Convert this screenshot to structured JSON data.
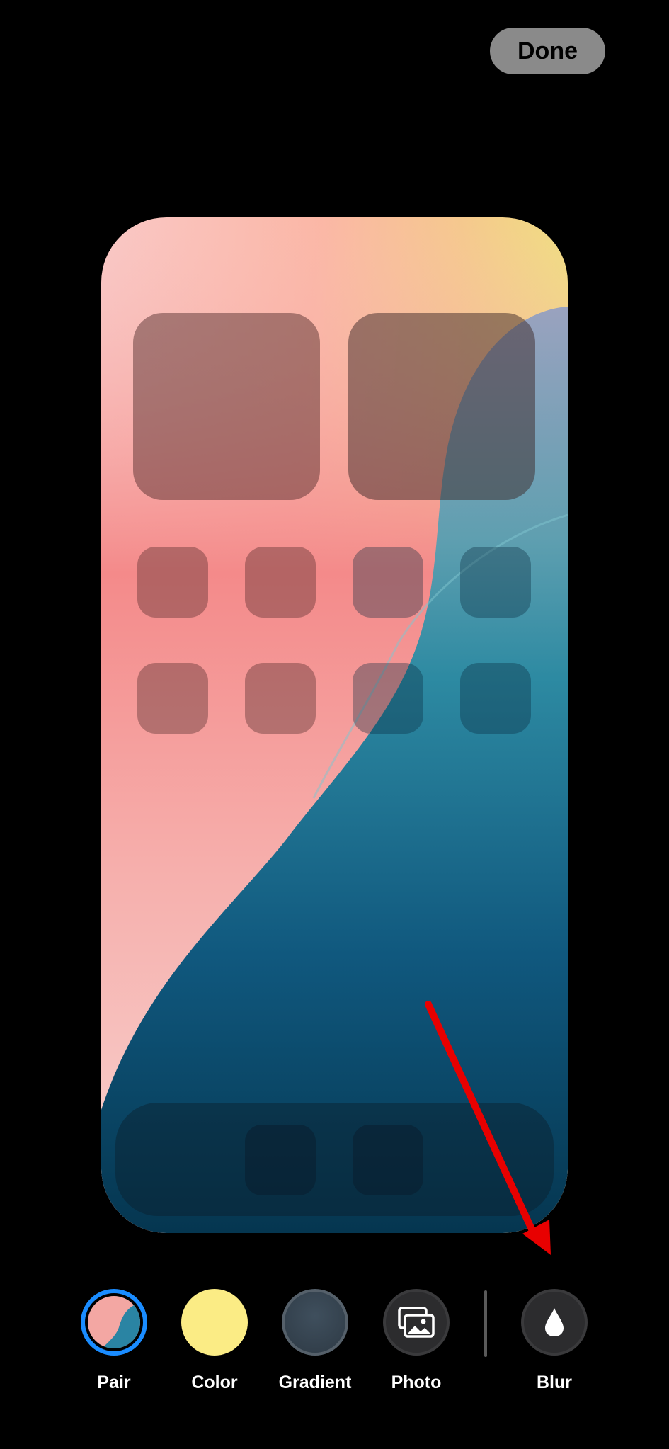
{
  "header": {
    "done_label": "Done"
  },
  "toolbar": {
    "items": [
      {
        "label": "Pair",
        "icon": "pair-wallpaper-icon",
        "selected": true
      },
      {
        "label": "Color",
        "icon": "color-swatch-icon",
        "color": "#fbec85"
      },
      {
        "label": "Gradient",
        "icon": "gradient-swatch-icon",
        "color": "#3a4a58"
      },
      {
        "label": "Photo",
        "icon": "photo-icon"
      },
      {
        "label": "Blur",
        "icon": "drop-icon"
      }
    ]
  },
  "colors": {
    "accent": "#1a8cff",
    "annotation_arrow": "#e80000"
  }
}
